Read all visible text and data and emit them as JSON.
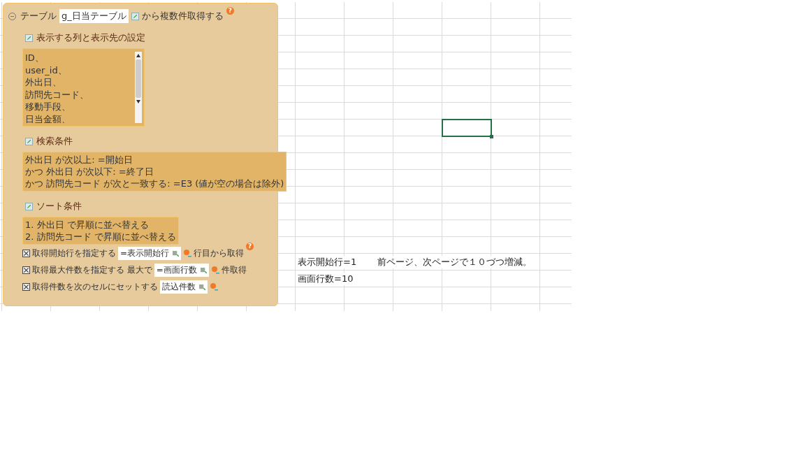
{
  "panel": {
    "expanded": true,
    "label": "テーブル",
    "table": "g_日当テーブル",
    "suffix": "から複数件取得する",
    "help": "?",
    "sections": [
      {
        "kind": "list",
        "title": "表示する列と表示先の設定",
        "lines": [
          "ID、",
          "user_id、",
          "外出日、",
          "訪問先コード、",
          "移動手段、",
          "日当金額、"
        ]
      },
      {
        "kind": "text",
        "title": "検索条件",
        "lines": [
          "外出日 が次以上: =開始日",
          "かつ 外出日 が次以下: =終了日",
          "かつ 訪問先コード が次と一致する: =E3 (値が空の場合は除外)"
        ]
      },
      {
        "kind": "text",
        "title": "ソート条件",
        "lines": [
          "1. 外出日 で昇順に並べ替える",
          "2. 訪問先コード で昇順に並べ替える"
        ]
      }
    ],
    "options": [
      {
        "checked": true,
        "label": "取得開始行を指定する",
        "value": "=表示開始行",
        "suffix": "行目から取得",
        "help": "?"
      },
      {
        "checked": true,
        "label": "取得最大件数を指定する 最大で",
        "value": "=画面行数",
        "suffix": "件取得"
      },
      {
        "checked": true,
        "label": "取得件数を次のセルにセットする",
        "value": "読込件数"
      }
    ]
  },
  "sheet": {
    "notes": [
      {
        "text": "表示開始行=1　　 前ページ、次ページで１０づつ増減。"
      },
      {
        "text": "画面行数=10"
      }
    ]
  }
}
